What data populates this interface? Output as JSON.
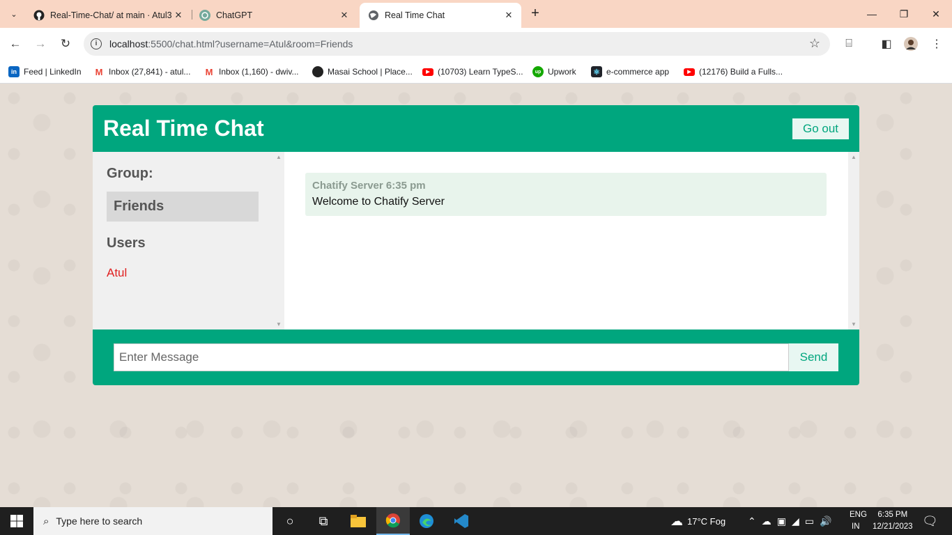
{
  "browser": {
    "tabs": [
      {
        "title": "Real-Time-Chat/ at main · Atul3",
        "icon": "github-icon",
        "active": false
      },
      {
        "title": "ChatGPT",
        "icon": "chatgpt-icon",
        "active": false
      },
      {
        "title": "Real Time Chat",
        "icon": "globe-icon",
        "active": true
      }
    ],
    "url_host": "localhost",
    "url_path": ":5500/chat.html?username=Atul&room=Friends",
    "bookmarks": [
      {
        "label": "Feed | LinkedIn",
        "icon": "linkedin-icon",
        "color": "#0a66c2"
      },
      {
        "label": "Inbox (27,841) - atul...",
        "icon": "gmail-icon",
        "color": "#ea4335"
      },
      {
        "label": "Inbox (1,160) - dwiv...",
        "icon": "gmail-icon",
        "color": "#ea4335"
      },
      {
        "label": "Masai School | Place...",
        "icon": "masai-icon",
        "color": "#222222"
      },
      {
        "label": "(10703) Learn TypeS...",
        "icon": "youtube-icon",
        "color": "#ff0000"
      },
      {
        "label": "Upwork",
        "icon": "upwork-icon",
        "color": "#14a800"
      },
      {
        "label": "e-commerce app",
        "icon": "react-icon",
        "color": "#20232a"
      },
      {
        "label": "(12176) Build a Fulls...",
        "icon": "youtube-icon",
        "color": "#ff0000"
      }
    ]
  },
  "app": {
    "title": "Real Time Chat",
    "go_out_label": "Go out",
    "group_label": "Group:",
    "room_name": "Friends",
    "users_label": "Users",
    "users": [
      "Atul"
    ],
    "messages": [
      {
        "sender": "Chatify Server",
        "time": "6:35 pm",
        "text": "Welcome to Chatify Server"
      }
    ],
    "message_placeholder": "Enter Message",
    "send_label": "Send",
    "accent_color": "#00a67e"
  },
  "taskbar": {
    "search_placeholder": "Type here to search",
    "weather": "17°C  Fog",
    "lang_top": "ENG",
    "lang_bottom": "IN",
    "time": "6:35 PM",
    "date": "12/21/2023"
  }
}
